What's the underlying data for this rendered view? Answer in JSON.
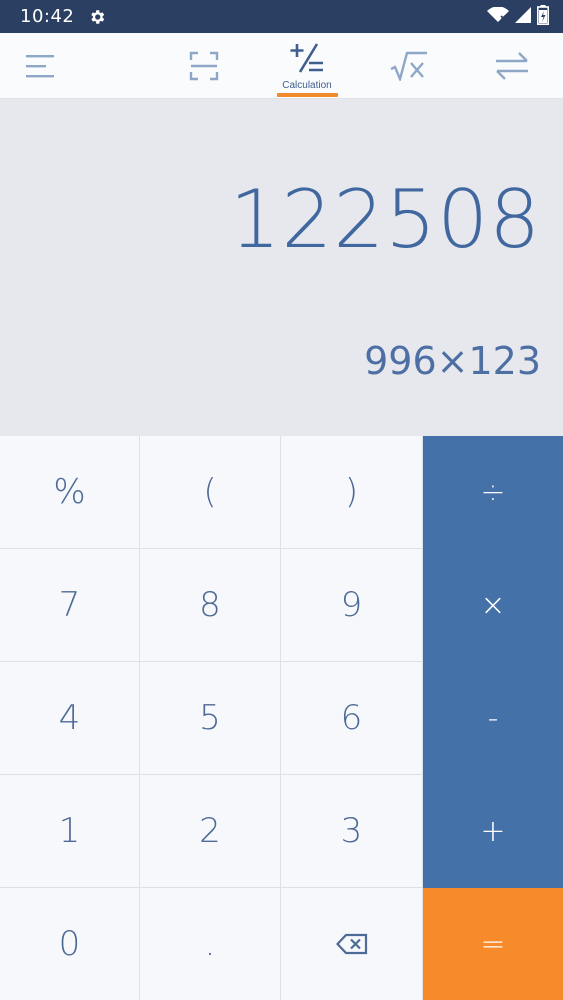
{
  "status_bar": {
    "time": "10:42",
    "icons": [
      "gear-icon",
      "wifi-icon",
      "signal-icon",
      "battery-icon"
    ]
  },
  "toolbar": {
    "active_tab_label": "Calculation",
    "icons": [
      "menu-icon",
      "scan-icon",
      "calculation-icon",
      "sqrt-x-icon",
      "convert-icon"
    ]
  },
  "display": {
    "result": "122508",
    "expression": "996×123"
  },
  "keys": {
    "percent": "%",
    "open_paren": "(",
    "close_paren": ")",
    "divide": "÷",
    "seven": "7",
    "eight": "8",
    "nine": "9",
    "multiply": "×",
    "four": "4",
    "five": "5",
    "six": "6",
    "minus": "-",
    "one": "1",
    "two": "2",
    "three": "3",
    "plus": "+",
    "zero": "0",
    "dot": ".",
    "equals": "="
  },
  "colors": {
    "status_bar": "#2b3f63",
    "accent": "#f28a2c",
    "operator": "#4471a8",
    "text_blue": "#41679f"
  }
}
